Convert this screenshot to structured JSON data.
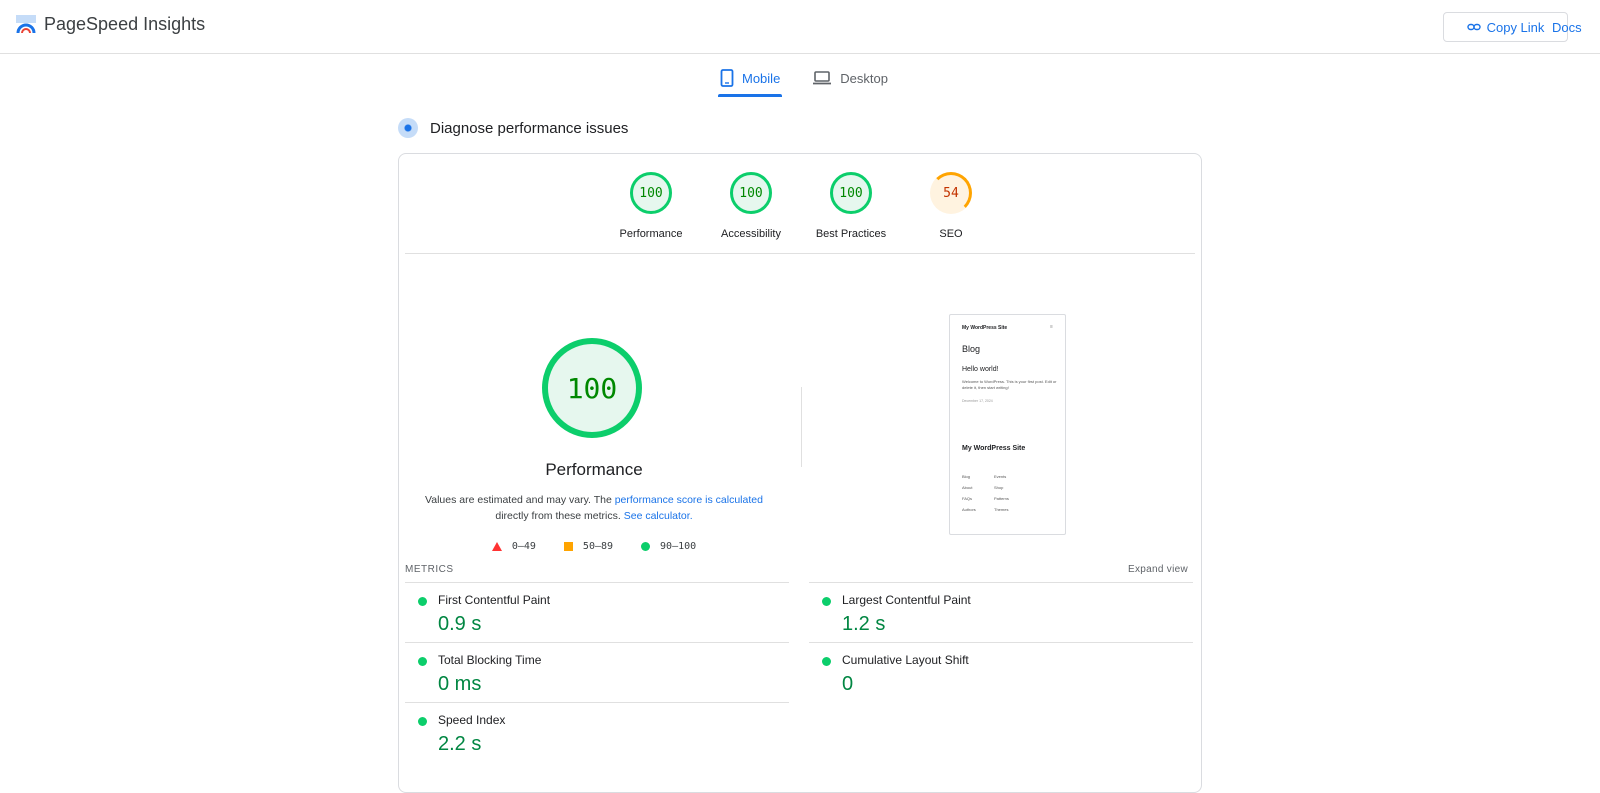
{
  "header": {
    "app_name": "PageSpeed Insights",
    "copy_link_label": "Copy Link",
    "docs_label": "Docs"
  },
  "tabs": [
    {
      "label": "Mobile",
      "icon": "phone-icon",
      "active": true
    },
    {
      "label": "Desktop",
      "icon": "laptop-icon",
      "active": false
    }
  ],
  "diagnose": {
    "title": "Diagnose performance issues"
  },
  "scores": [
    {
      "value": "100",
      "label": "Performance",
      "rating": "good"
    },
    {
      "value": "100",
      "label": "Accessibility",
      "rating": "good"
    },
    {
      "value": "100",
      "label": "Best Practices",
      "rating": "good"
    },
    {
      "value": "54",
      "label": "SEO",
      "rating": "average"
    }
  ],
  "main_score": {
    "value": "100",
    "title": "Performance",
    "note_prefix": "Values are estimated and may vary. The ",
    "note_link1": "performance score is calculated",
    "note_middle": " directly from these metrics. ",
    "note_link2": "See calculator.",
    "legend": [
      "0–49",
      "50–89",
      "90–100"
    ]
  },
  "screenshot": {
    "site_title": "My WordPress Site",
    "menu": "≡",
    "heading": "Blog",
    "post_title": "Hello world!",
    "post_body": "Welcome to WordPress. This is your first post. Edit or delete it, then start writing!",
    "post_date": "December 17, 2024",
    "footer_title": "My WordPress Site",
    "links": [
      "Blog",
      "Events",
      "About",
      "Shop",
      "FAQs",
      "Patterns",
      "Authors",
      "Themes"
    ]
  },
  "metrics": {
    "heading": "METRICS",
    "expand_label": "Expand view",
    "items": [
      {
        "label": "First Contentful Paint",
        "value": "0.9 s"
      },
      {
        "label": "Largest Contentful Paint",
        "value": "1.2 s"
      },
      {
        "label": "Total Blocking Time",
        "value": "0 ms"
      },
      {
        "label": "Cumulative Layout Shift",
        "value": "0"
      },
      {
        "label": "Speed Index",
        "value": "2.2 s"
      }
    ]
  },
  "colors": {
    "accent": "#1a73e8",
    "good": "#0cce6b",
    "average": "#ffa400",
    "poor": "#ff3333"
  }
}
